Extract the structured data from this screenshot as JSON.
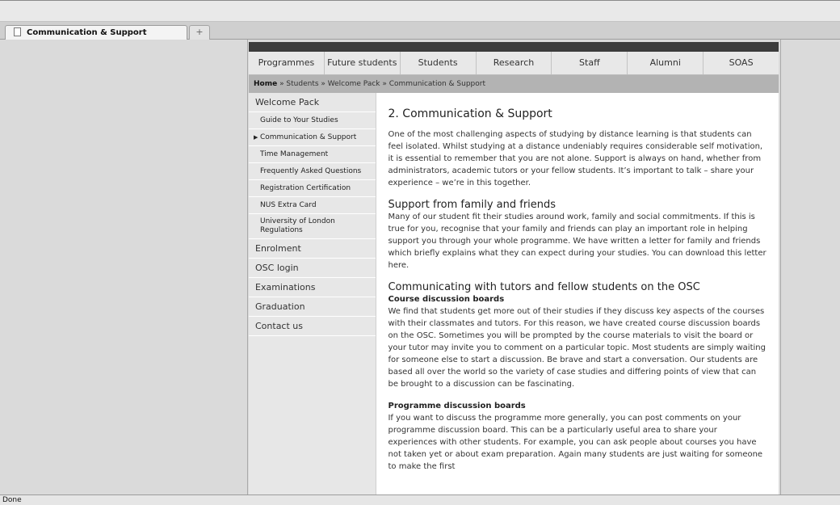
{
  "browser": {
    "tab_title": "Communication & Support",
    "new_tab_symbol": "+",
    "status_text": "Done"
  },
  "nav": {
    "items": [
      "Programmes",
      "Future students",
      "Students",
      "Research",
      "Staff",
      "Alumni",
      "SOAS"
    ]
  },
  "breadcrumb": {
    "home": "Home",
    "rest": " » Students » Welcome Pack » Communication & Support"
  },
  "sidebar": {
    "heading": "Welcome Pack",
    "sub_items": [
      "Guide to Your Studies",
      "Communication & Support",
      "Time Management",
      "Frequently Asked Questions",
      "Registration Certification",
      "NUS Extra Card",
      "University of London Regulations"
    ],
    "current_marker": "▶",
    "sections": [
      "Enrolment",
      "OSC login",
      "Examinations",
      "Graduation",
      "Contact us"
    ]
  },
  "content": {
    "title": "2. Communication & Support",
    "intro": "One of the most challenging aspects of studying by distance learning is that students can feel isolated. Whilst studying at a distance undeniably requires considerable self motivation, it is essential to remember that you are not alone. Support is always on hand, whether from administrators, academic tutors or your fellow students. It’s important to talk – share your experience – we’re in this together.",
    "family_heading": "Support from family and friends",
    "family_text": "Many of our student fit their studies around work, family and social commitments. If this is true for you, recognise that your family and friends can play an important role in helping support you through your whole programme. We have written a letter for family and friends which briefly explains what they can expect during your studies. You can download this letter here.",
    "osc_heading": "Communicating with tutors and fellow students on the OSC",
    "course_heading": "Course discussion boards",
    "course_text": "We find that students get more out of their studies if they discuss key aspects of the courses with their classmates and tutors. For this reason, we have created course discussion boards on the OSC. Sometimes you will be prompted by the course materials to visit the board or your tutor may invite you to comment on a particular topic. Most students are simply waiting for someone else to start a discussion. Be brave and start a conversation. Our students are based all over the world so the variety of case studies and differing points of view that can be brought to a discussion can be fascinating.",
    "programme_heading": "Programme discussion boards",
    "programme_text": "If you want to discuss the programme more generally, you can post comments on your programme discussion board. This can be a particularly useful area to share your experiences with other students. For example, you can ask people about courses you have not taken yet or about exam preparation. Again many students are just waiting for someone to make the first"
  }
}
